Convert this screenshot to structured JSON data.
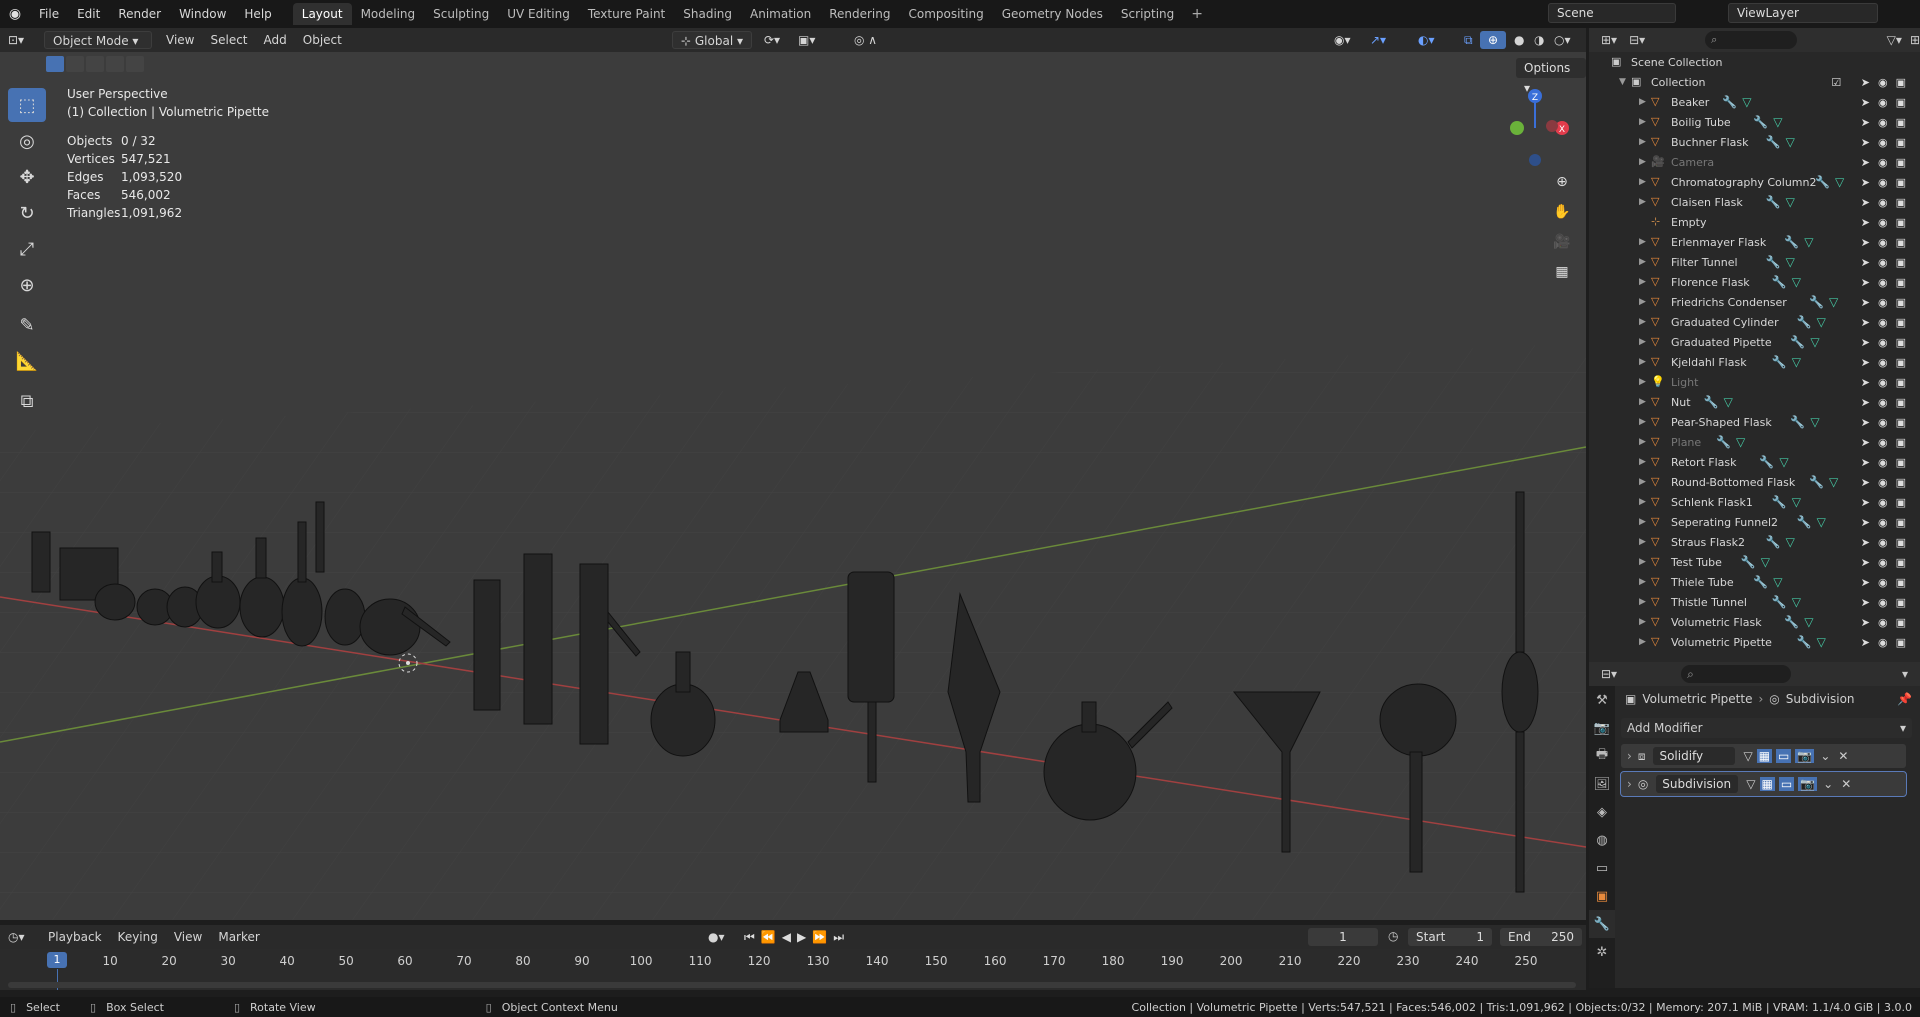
{
  "menubar": {
    "items": [
      "File",
      "Edit",
      "Render",
      "Window",
      "Help"
    ],
    "workspaces": [
      "Layout",
      "Modeling",
      "Sculpting",
      "UV Editing",
      "Texture Paint",
      "Shading",
      "Animation",
      "Rendering",
      "Compositing",
      "Geometry Nodes",
      "Scripting"
    ],
    "active_workspace": "Layout",
    "scene": "Scene",
    "view_layer": "ViewLayer"
  },
  "viewport_header": {
    "mode": "Object Mode",
    "menus": [
      "View",
      "Select",
      "Add",
      "Object"
    ],
    "transform_orientation": "Global",
    "options": "Options"
  },
  "viewport": {
    "perspective": "User Perspective",
    "context": "(1) Collection | Volumetric Pipette",
    "stats": [
      {
        "label": "Objects",
        "value": "0 / 32"
      },
      {
        "label": "Vertices",
        "value": "547,521"
      },
      {
        "label": "Edges",
        "value": "1,093,520"
      },
      {
        "label": "Faces",
        "value": "546,002"
      },
      {
        "label": "Triangles",
        "value": "1,091,962"
      }
    ],
    "gizmo": {
      "z": "Z",
      "x": "X"
    }
  },
  "outliner": {
    "root": "Scene Collection",
    "collection": "Collection",
    "items": [
      {
        "name": "Beaker",
        "icon": "mesh",
        "dim": false
      },
      {
        "name": "Boilig Tube",
        "icon": "mesh",
        "dim": false
      },
      {
        "name": "Buchner Flask",
        "icon": "mesh",
        "dim": false
      },
      {
        "name": "Camera",
        "icon": "camera",
        "dim": true
      },
      {
        "name": "Chromatography Column2",
        "icon": "mesh",
        "dim": false
      },
      {
        "name": "Claisen Flask",
        "icon": "mesh",
        "dim": false
      },
      {
        "name": "Empty",
        "icon": "empty",
        "dim": false
      },
      {
        "name": "Erlenmayer Flask",
        "icon": "mesh",
        "dim": false
      },
      {
        "name": "Filter Tunnel",
        "icon": "mesh",
        "dim": false
      },
      {
        "name": "Florence Flask",
        "icon": "mesh",
        "dim": false
      },
      {
        "name": "Friedrichs Condenser",
        "icon": "mesh",
        "dim": false
      },
      {
        "name": "Graduated Cylinder",
        "icon": "mesh",
        "dim": false
      },
      {
        "name": "Graduated Pipette",
        "icon": "mesh",
        "dim": false
      },
      {
        "name": "Kjeldahl Flask",
        "icon": "mesh",
        "dim": false
      },
      {
        "name": "Light",
        "icon": "light",
        "dim": true
      },
      {
        "name": "Nut",
        "icon": "mesh",
        "dim": false
      },
      {
        "name": "Pear-Shaped Flask",
        "icon": "mesh",
        "dim": false
      },
      {
        "name": "Plane",
        "icon": "mesh",
        "dim": true
      },
      {
        "name": "Retort Flask",
        "icon": "mesh",
        "dim": false
      },
      {
        "name": "Round-Bottomed Flask",
        "icon": "mesh",
        "dim": false
      },
      {
        "name": "Schlenk Flask1",
        "icon": "mesh",
        "dim": false
      },
      {
        "name": "Seperating Funnel2",
        "icon": "mesh",
        "dim": false
      },
      {
        "name": "Straus Flask2",
        "icon": "mesh",
        "dim": false
      },
      {
        "name": "Test Tube",
        "icon": "mesh",
        "dim": false
      },
      {
        "name": "Thiele Tube",
        "icon": "mesh",
        "dim": false
      },
      {
        "name": "Thistle Tunnel",
        "icon": "mesh",
        "dim": false
      },
      {
        "name": "Volumetric Flask",
        "icon": "mesh",
        "dim": false
      },
      {
        "name": "Volumetric Pipette",
        "icon": "mesh",
        "dim": false
      }
    ]
  },
  "properties": {
    "object": "Volumetric Pipette",
    "modifier_context": "Subdivision",
    "add_modifier": "Add Modifier",
    "modifiers": [
      "Solidify",
      "Subdivision"
    ]
  },
  "timeline": {
    "menus": [
      "Playback",
      "Keying",
      "View",
      "Marker"
    ],
    "current_frame": "1",
    "start_label": "Start",
    "start": "1",
    "end_label": "End",
    "end": "250",
    "ticks": [
      "1",
      "10",
      "20",
      "30",
      "40",
      "50",
      "60",
      "70",
      "80",
      "90",
      "100",
      "110",
      "120",
      "130",
      "140",
      "150",
      "160",
      "170",
      "180",
      "190",
      "200",
      "210",
      "220",
      "230",
      "240",
      "250"
    ]
  },
  "statusbar": {
    "hints": [
      "Select",
      "Box Select",
      "Rotate View",
      "Object Context Menu"
    ],
    "info": "Collection | Volumetric Pipette | Verts:547,521 | Faces:546,002 | Tris:1,091,962 | Objects:0/32 | Memory: 207.1 MiB | VRAM: 1.1/4.0 GiB | 3.0.0"
  },
  "colors": {
    "accent": "#4772b3",
    "mesh_icon": "#e88a3c",
    "modifier": "#7fa7e0",
    "vertex_data": "#46c9a4"
  }
}
